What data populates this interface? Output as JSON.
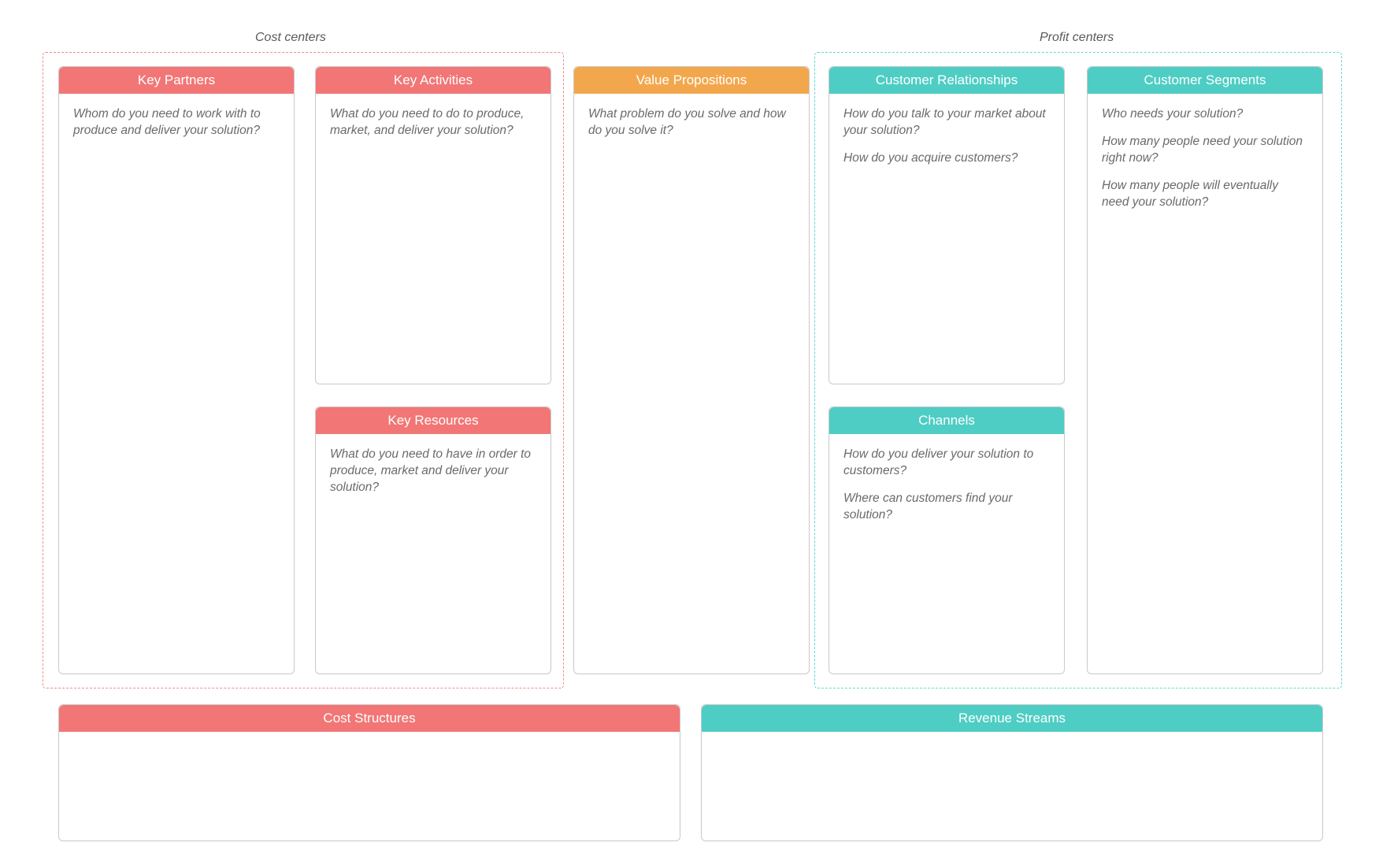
{
  "labels": {
    "cost_centers": "Cost centers",
    "profit_centers": "Profit centers"
  },
  "cards": {
    "key_partners": {
      "title": "Key Partners",
      "body": [
        "Whom do you need to work with to produce and deliver your solution?"
      ]
    },
    "key_activities": {
      "title": "Key Activities",
      "body": [
        "What do you need to do to produce, market, and deliver your solution?"
      ]
    },
    "key_resources": {
      "title": "Key Resources",
      "body": [
        "What do you need to have in order to produce, market and deliver your solution?"
      ]
    },
    "value_propositions": {
      "title": "Value Propositions",
      "body": [
        "What problem do you solve and how do you solve it?"
      ]
    },
    "customer_relationships": {
      "title": "Customer Relationships",
      "body": [
        "How do you talk to your market about your solution?",
        "How do you acquire customers?"
      ]
    },
    "channels": {
      "title": "Channels",
      "body": [
        "How do you deliver your solution to customers?",
        "Where can customers find your solution?"
      ]
    },
    "customer_segments": {
      "title": "Customer Segments",
      "body": [
        "Who needs your solution?",
        "How many people need your solution right now?",
        "How many people will eventually need your solution?"
      ]
    },
    "cost_structures": {
      "title": "Cost Structures",
      "body": []
    },
    "revenue_streams": {
      "title": "Revenue Streams",
      "body": []
    }
  }
}
